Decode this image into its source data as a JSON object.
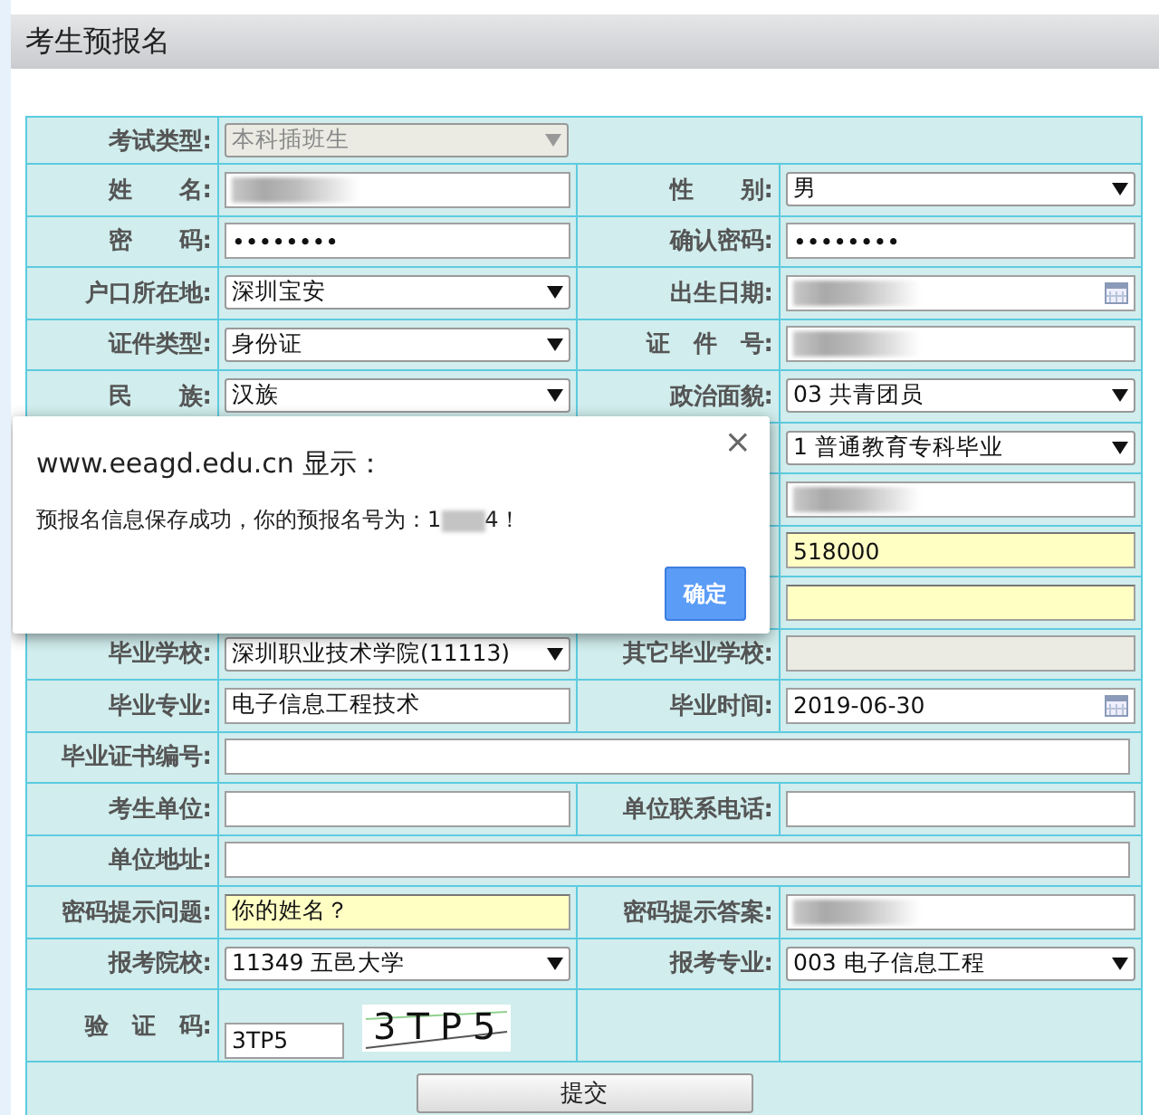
{
  "header": {
    "title": "考生预报名"
  },
  "rows": [
    {
      "wide": true,
      "left": {
        "label": "考试类型:",
        "field": {
          "kind": "select",
          "value": "本科插班生",
          "disabled": true
        }
      }
    },
    {
      "left": {
        "label": "姓　　名:",
        "field": {
          "kind": "text",
          "redacted": true
        }
      },
      "right": {
        "label": "性　　别:",
        "field": {
          "kind": "select",
          "value": "男"
        }
      }
    },
    {
      "left": {
        "label": "密　　码:",
        "field": {
          "kind": "text",
          "value": "••••••••"
        }
      },
      "right": {
        "label": "确认密码:",
        "field": {
          "kind": "text",
          "value": "••••••••"
        }
      }
    },
    {
      "left": {
        "label": "户口所在地:",
        "field": {
          "kind": "select",
          "value": "深圳宝安"
        }
      },
      "right": {
        "label": "出生日期:",
        "field": {
          "kind": "date",
          "redacted": true
        }
      }
    },
    {
      "left": {
        "label": "证件类型:",
        "field": {
          "kind": "select",
          "value": "身份证"
        }
      },
      "right": {
        "label": "证　件　号:",
        "field": {
          "kind": "text",
          "redacted": true
        }
      }
    },
    {
      "left": {
        "label": "民　　族:",
        "field": {
          "kind": "select",
          "value": "汉族"
        }
      },
      "right": {
        "label": "政治面貌:",
        "field": {
          "kind": "select",
          "value": "03 共青团员"
        }
      }
    },
    {
      "right": {
        "field": {
          "kind": "select",
          "value": "1 普通教育专科毕业"
        }
      }
    },
    {
      "right": {
        "field": {
          "kind": "text",
          "redacted": true
        }
      }
    },
    {
      "right": {
        "field": {
          "kind": "text",
          "value": "518000",
          "highlighted": true
        }
      }
    },
    {
      "right": {
        "field": {
          "kind": "text",
          "highlighted": true
        }
      }
    },
    {
      "left": {
        "label": "毕业学校:",
        "field": {
          "kind": "select",
          "value": "深圳职业技术学院(11113)"
        }
      },
      "right": {
        "label": "其它毕业学校:",
        "field": {
          "kind": "text",
          "disabled": true
        }
      }
    },
    {
      "left": {
        "label": "毕业专业:",
        "field": {
          "kind": "text",
          "value": "电子信息工程技术"
        }
      },
      "right": {
        "label": "毕业时间:",
        "field": {
          "kind": "date",
          "value": "2019-06-30"
        }
      }
    },
    {
      "wide": true,
      "left": {
        "label": "毕业证书编号:",
        "field": {
          "kind": "text"
        }
      }
    },
    {
      "left": {
        "label": "考生单位:",
        "field": {
          "kind": "text"
        }
      },
      "right": {
        "label": "单位联系电话:",
        "field": {
          "kind": "text"
        }
      }
    },
    {
      "wide": true,
      "left": {
        "label": "单位地址:",
        "field": {
          "kind": "text"
        }
      }
    },
    {
      "left": {
        "label": "密码提示问题:",
        "field": {
          "kind": "text",
          "value": "你的姓名？",
          "highlighted": true
        }
      },
      "right": {
        "label": "密码提示答案:",
        "field": {
          "kind": "text",
          "redacted": true
        }
      }
    },
    {
      "left": {
        "label": "报考院校:",
        "field": {
          "kind": "select",
          "value": "11349 五邑大学"
        }
      },
      "right": {
        "label": "报考专业:",
        "field": {
          "kind": "select",
          "value": "003 电子信息工程"
        }
      }
    },
    {
      "left": {
        "label": "验　证　码:",
        "field": {
          "kind": "captcha",
          "value": "3TP5",
          "captcha_text": "3TP5"
        }
      }
    }
  ],
  "submit": {
    "label": "提交"
  },
  "dialog": {
    "title": "www.eeagd.edu.cn 显示：",
    "close": "×",
    "message_before": "预报名信息保存成功，你的预报名号为：1",
    "message_redacted": true,
    "message_after": "4！",
    "button": "确定"
  }
}
